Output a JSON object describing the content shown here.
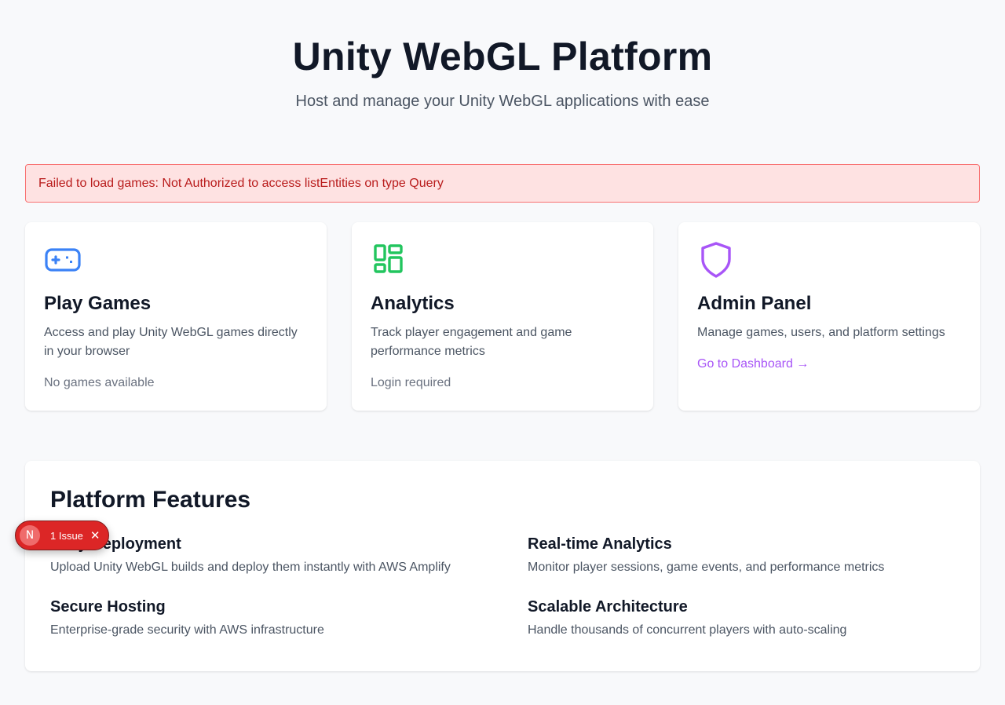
{
  "hero": {
    "title": "Unity WebGL Platform",
    "subtitle": "Host and manage your Unity WebGL applications with ease"
  },
  "error": {
    "message": "Failed to load games: Not Authorized to access listEntities on type Query"
  },
  "cards": [
    {
      "icon": "gamepad-icon",
      "icon_color": "#3b82f6",
      "title": "Play Games",
      "description": "Access and play Unity WebGL games directly in your browser",
      "status": "No games available"
    },
    {
      "icon": "dashboard-grid-icon",
      "icon_color": "#22c55e",
      "title": "Analytics",
      "description": "Track player engagement and game performance metrics",
      "status": "Login required"
    },
    {
      "icon": "shield-icon",
      "icon_color": "#a855f7",
      "title": "Admin Panel",
      "description": "Manage games, users, and platform settings",
      "link": "Go to Dashboard →"
    }
  ],
  "features": {
    "title": "Platform Features",
    "items": [
      {
        "title": "Easy Deployment",
        "description": "Upload Unity WebGL builds and deploy them instantly with AWS Amplify"
      },
      {
        "title": "Real-time Analytics",
        "description": "Monitor player sessions, game events, and performance metrics"
      },
      {
        "title": "Secure Hosting",
        "description": "Enterprise-grade security with AWS infrastructure"
      },
      {
        "title": "Scalable Architecture",
        "description": "Handle thousands of concurrent players with auto-scaling"
      }
    ]
  },
  "dev_overlay": {
    "badge_letter": "N",
    "issue_label": "1 Issue",
    "close_glyph": "✕",
    "color": "#dc2626"
  }
}
